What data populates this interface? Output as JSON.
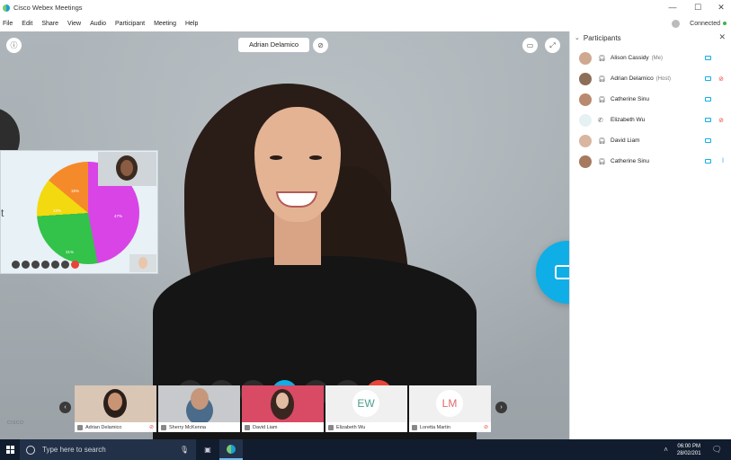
{
  "window": {
    "title": "Cisco Webex Meetings",
    "controls": {
      "minimize": "—",
      "maximize": "☐",
      "close": "✕"
    }
  },
  "menu": [
    "File",
    "Edit",
    "Share",
    "View",
    "Audio",
    "Participant",
    "Meeting",
    "Help"
  ],
  "connection": {
    "label": "Connected",
    "dot_color": "#3bb54a"
  },
  "stage": {
    "speaker_name": "Adrian Delamico",
    "shared_content": {
      "letter": "t",
      "pie": {
        "slices": [
          {
            "label": "47%",
            "color": "#d944e6"
          },
          {
            "label": "31%",
            "color": "#33c24a"
          },
          {
            "label": "13%",
            "color": "#f3d90f"
          },
          {
            "label": "15%",
            "color": "#f58a2a"
          }
        ]
      }
    }
  },
  "controls": {
    "mute": "mic-off-icon",
    "video": "video-off-icon",
    "share": "share-icon",
    "participants": "participants-icon",
    "chat": "chat-icon",
    "more": "···",
    "leave": "✕"
  },
  "filmstrip": [
    {
      "name": "Adrian Delamico",
      "type": "video",
      "muted": true,
      "bg": "#d9c6b5"
    },
    {
      "name": "Sherry McKenna",
      "type": "video",
      "muted": false,
      "bg": "#c7c9cc"
    },
    {
      "name": "David Liam",
      "type": "video",
      "muted": false,
      "bg": "#d94a65"
    },
    {
      "name": "Elizabeth Wu",
      "type": "initials",
      "initials": "EW",
      "initials_color": "#4d9f8c",
      "muted": false,
      "bg": "#f0f0f0"
    },
    {
      "name": "Loretta Martin",
      "type": "initials",
      "initials": "LM",
      "initials_color": "#e06a6a",
      "muted": true,
      "bg": "#f0f0f0"
    }
  ],
  "participants_panel": {
    "title": "Participants",
    "items": [
      {
        "name": "Alison Cassidy",
        "role": "(Me)",
        "muted": false,
        "avatar": "#cfa98f"
      },
      {
        "name": "Adrian Delamico",
        "role": "(Host)",
        "muted": true,
        "avatar": "#8d6e58"
      },
      {
        "name": "Catherine Sinu",
        "role": "",
        "muted": false,
        "avatar": "#b98b6e"
      },
      {
        "name": "Elizabeth Wu",
        "role": "",
        "muted": true,
        "avatar": "#e6f1f4",
        "phone": true
      },
      {
        "name": "David Liam",
        "role": "",
        "muted": false,
        "avatar": "#d8b6a0"
      },
      {
        "name": "Catherine Sinu",
        "role": "",
        "muted": false,
        "avatar": "#a57a5e"
      }
    ]
  },
  "taskbar": {
    "search_placeholder": "Type here to search",
    "time": "06:00 PM",
    "date": "28/02/201"
  },
  "brand": "CISCO",
  "accent_color": "#10aee6",
  "danger_color": "#e8443a"
}
